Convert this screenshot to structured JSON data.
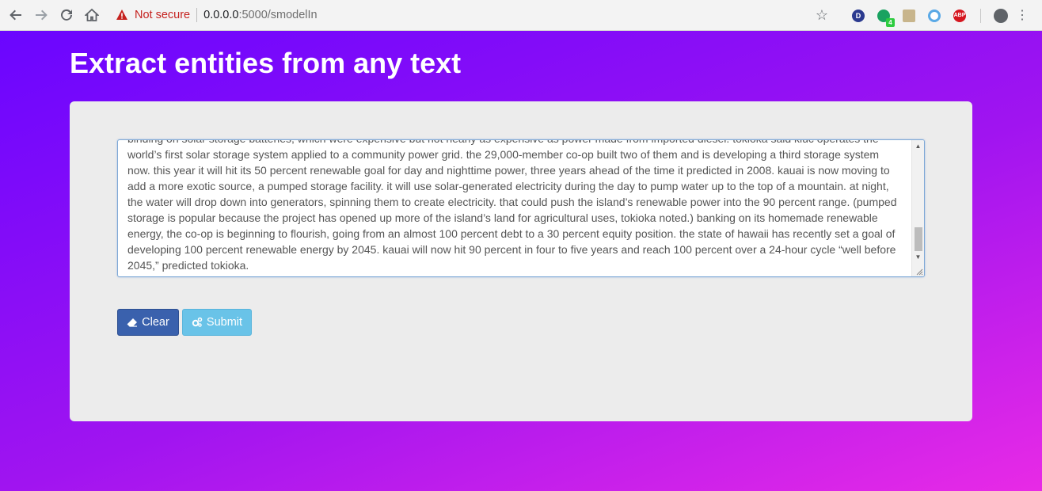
{
  "browser": {
    "security_label": "Not secure",
    "url_host": "0.0.0.0",
    "url_path": ":5000/smodelIn",
    "extensions": {
      "d_label": "D",
      "grammarly_badge": "4",
      "abp_label": "ABP"
    }
  },
  "page": {
    "title": "Extract entities from any text"
  },
  "textarea": {
    "line_0": "binding on solar storage batteries, which were expensive but not nearly as expensive as power made from imported diesel. tokioka said kiuc operates the",
    "line_1": "world’s first solar storage system applied to a community power grid.  the 29,000-member co-op built two of them and is developing a third storage system",
    "line_2": "now. this year it will hit its 50 percent renewable goal for day and nighttime power, three years ahead of the time it predicted in 2008.  kauai is now moving to",
    "line_3": "add a more exotic source, a pumped storage facility. it will use solar-generated electricity during the day to pump water up to the top of a mountain. at night,",
    "line_4": "the water will drop down into generators, spinning them to create electricity. that could push the island’s renewable power into the 90 percent range. (pumped",
    "line_5": "storage is popular because the project has opened up more of the island’s land for agricultural uses, tokioka noted.)  banking on its homemade renewable",
    "line_6": "energy, the co-op is beginning to flourish, going from an almost 100 percent debt to a 30 percent equity position. the state of hawaii has recently set a goal of",
    "line_7": "developing 100 percent renewable energy by 2045. kauai will now hit 90 percent in four to five years and reach 100 percent over a 24-hour cycle “well before",
    "line_8": "2045,” predicted tokioka."
  },
  "buttons": {
    "clear_label": "Clear",
    "submit_label": "Submit"
  },
  "colors": {
    "gradient_start": "#6a05ff",
    "gradient_end": "#e82ae6",
    "clear_button": "#3a61ad",
    "submit_button": "#62c1e8"
  }
}
